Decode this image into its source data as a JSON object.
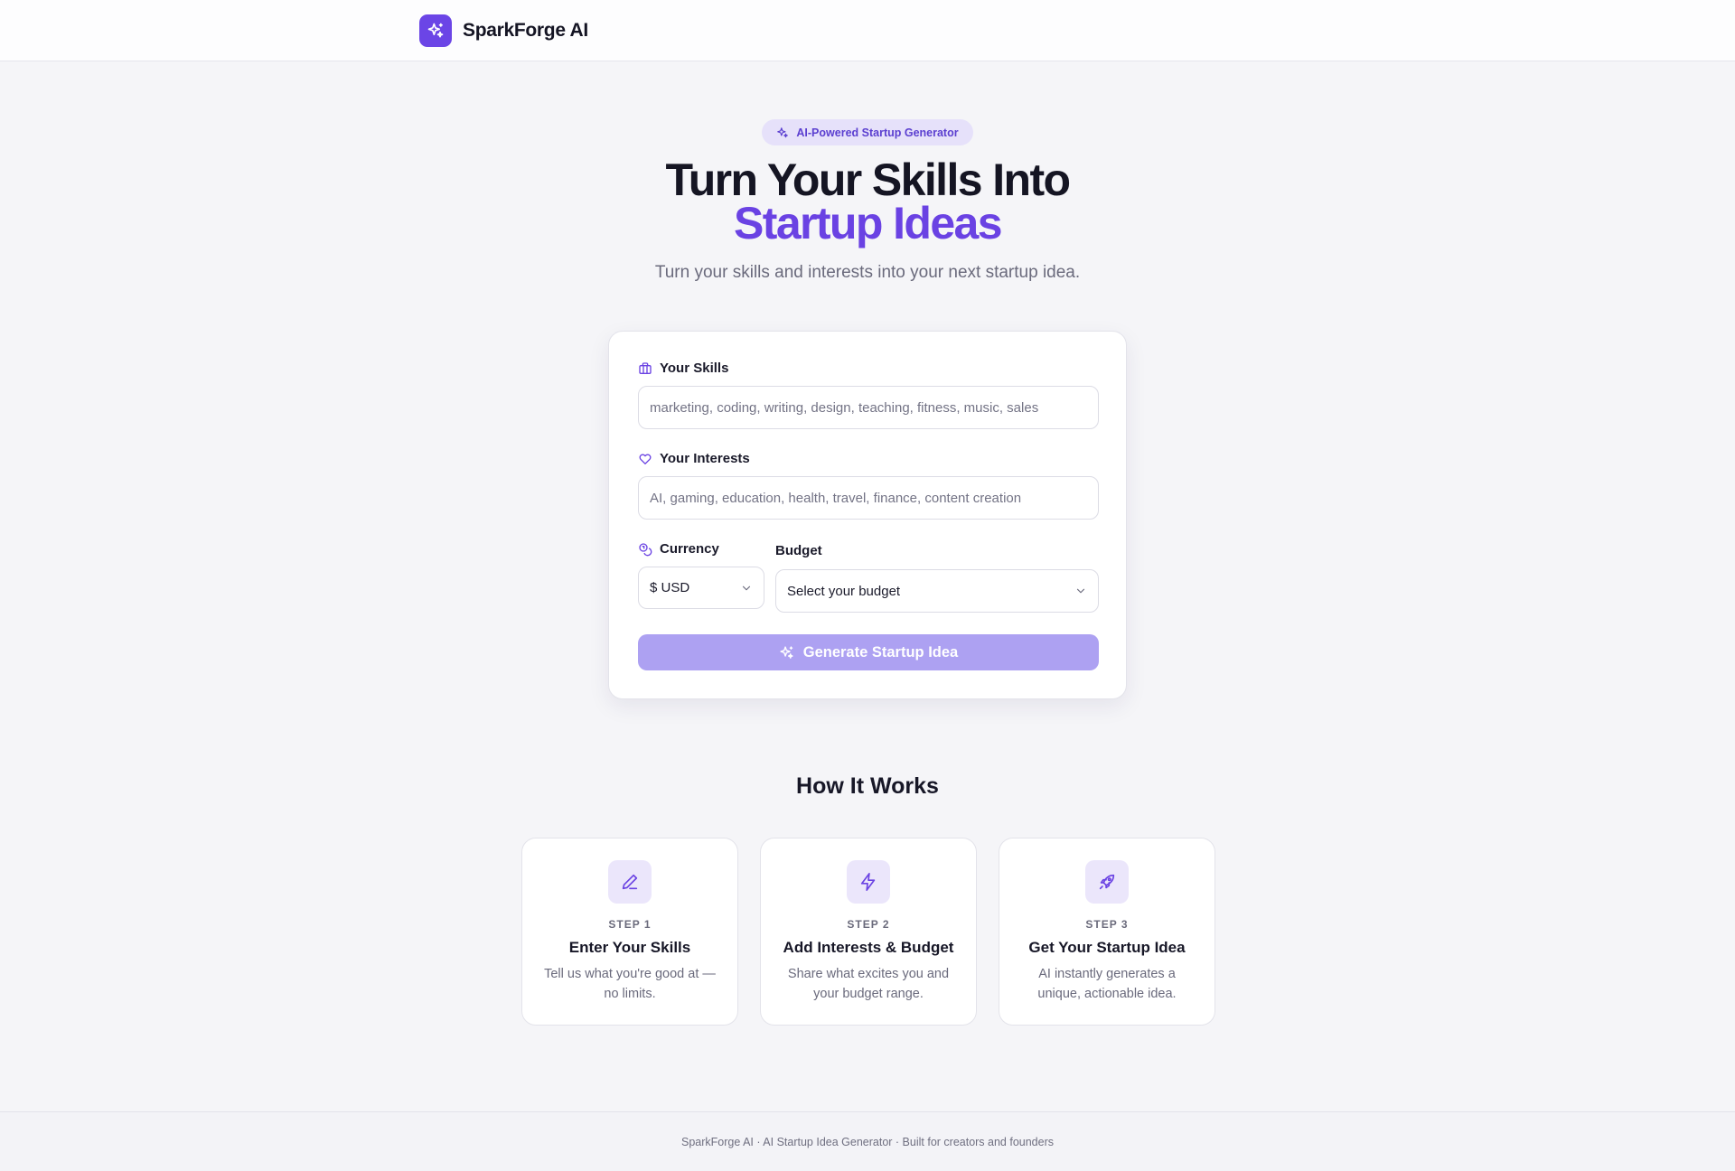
{
  "header": {
    "brand_name": "SparkForge AI",
    "logo_icon": "sparkles-icon"
  },
  "hero": {
    "badge": "AI-Powered Startup Generator",
    "title_line1": "Turn Your Skills Into",
    "title_line2": "Startup Ideas",
    "subtitle": "Turn your skills and interests into your next startup idea."
  },
  "form": {
    "skills": {
      "label": "Your Skills",
      "icon": "briefcase-icon",
      "value": "",
      "placeholder": "marketing, coding, writing, design, teaching, fitness, music, sales"
    },
    "interests": {
      "label": "Your Interests",
      "icon": "heart-icon",
      "value": "",
      "placeholder": "AI, gaming, education, health, travel, finance, content creation"
    },
    "currency": {
      "label": "Currency",
      "icon": "coins-icon",
      "selected": "$ USD"
    },
    "budget": {
      "label": "Budget",
      "selected": "Select your budget"
    },
    "generate_label": "Generate Startup Idea"
  },
  "how_it_works": {
    "title": "How It Works",
    "steps": [
      {
        "number": "STEP 1",
        "title": "Enter Your Skills",
        "description": "Tell us what you're good at — no limits.",
        "icon": "pencil-icon"
      },
      {
        "number": "STEP 2",
        "title": "Add Interests & Budget",
        "description": "Share what excites you and your budget range.",
        "icon": "lightning-icon"
      },
      {
        "number": "STEP 3",
        "title": "Get Your Startup Idea",
        "description": "AI instantly generates a unique, actionable idea.",
        "icon": "rocket-icon"
      }
    ]
  },
  "footer": {
    "text": "SparkForge AI · AI Startup Idea Generator · Built for creators and founders"
  },
  "colors": {
    "accent": "#6a42e3",
    "button_disabled": "#ada1f2",
    "badge_bg": "#e6e1fa"
  }
}
